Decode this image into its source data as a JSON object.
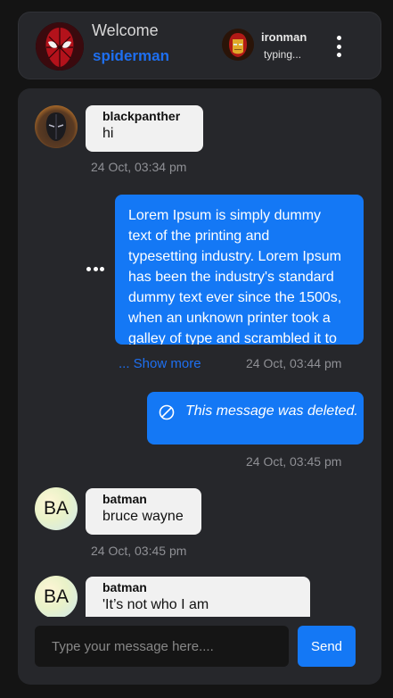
{
  "header": {
    "welcome": "Welcome",
    "username": "spiderman",
    "peer": {
      "name": "ironman",
      "status": "typing..."
    }
  },
  "messages": [
    {
      "type": "incoming",
      "sender": "blackpanther",
      "text": "hi",
      "time": "24 Oct, 03:34 pm"
    },
    {
      "type": "outgoing",
      "text": "Lorem Ipsum is simply dummy text of the printing and typesetting industry. Lorem Ipsum has been the industry's standard dummy text ever since the 1500s, when an unknown printer took a galley of type and scrambled it to make a type specimen book.",
      "show_more": "... Show more",
      "time": "24 Oct, 03:44 pm"
    },
    {
      "type": "outgoing-deleted",
      "text": "This message was deleted.",
      "time": "24 Oct, 03:45 pm"
    },
    {
      "type": "incoming",
      "sender": "batman",
      "avatar_initials": "BA",
      "text": "bruce wayne",
      "time": "24 Oct, 03:45 pm"
    },
    {
      "type": "incoming",
      "sender": "batman",
      "avatar_initials": "BA",
      "text": "'It’s not who I am"
    }
  ],
  "composer": {
    "placeholder": "Type your message here....",
    "send_label": "Send"
  },
  "colors": {
    "accent": "#1478f5",
    "link": "#1e6ff0",
    "panel": "#26272b",
    "background": "#141414"
  }
}
